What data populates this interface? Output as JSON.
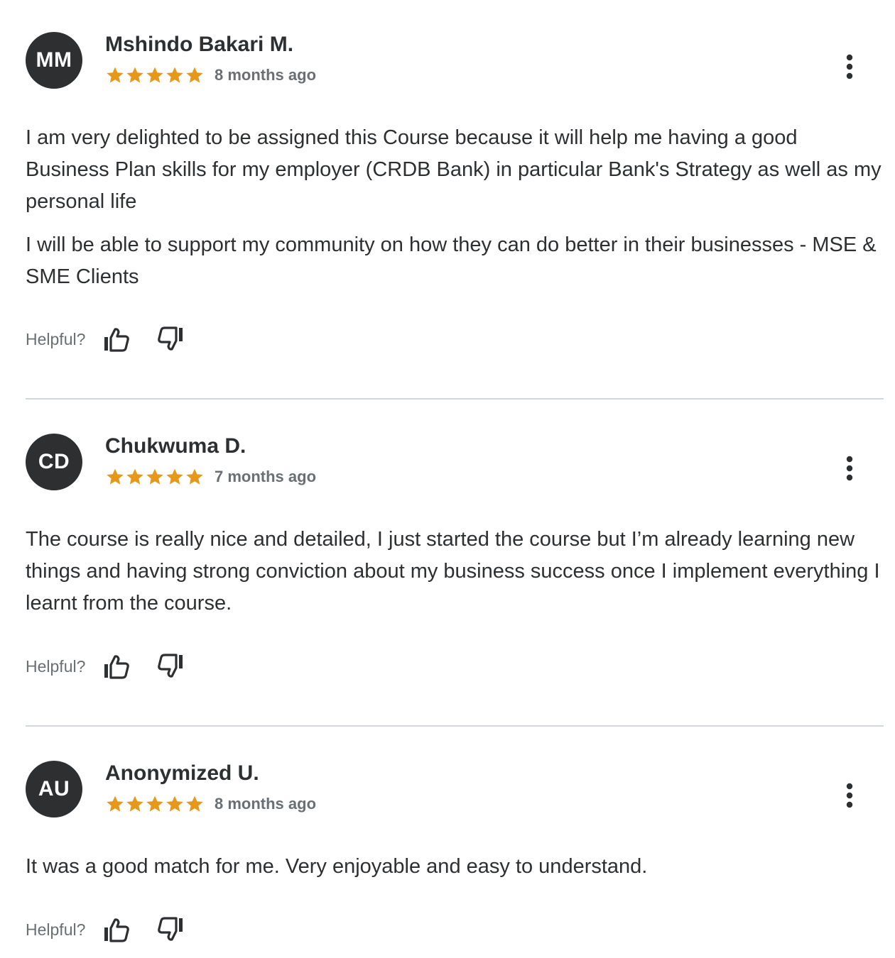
{
  "reviews": [
    {
      "initials": "MM",
      "name": "Mshindo Bakari M.",
      "rating": 5,
      "date": "8 months ago",
      "paragraphs": [
        "I am very delighted to be assigned this Course because it will help me having a good Business Plan skills for my employer (CRDB Bank) in particular Bank's Strategy as well as my personal life",
        "I will be able to support my community on how they can do better in their businesses - MSE & SME Clients"
      ],
      "helpful_label": "Helpful?"
    },
    {
      "initials": "CD",
      "name": "Chukwuma D.",
      "rating": 5,
      "date": "7 months ago",
      "paragraphs": [
        "The course is really nice and detailed, I just started the course but I’m already learning new things and having strong conviction about my business success once I implement everything I learnt from the course."
      ],
      "helpful_label": "Helpful?"
    },
    {
      "initials": "AU",
      "name": "Anonymized U.",
      "rating": 5,
      "date": "8 months ago",
      "paragraphs": [
        "It was a good match for me. Very enjoyable and easy to understand."
      ],
      "helpful_label": "Helpful?"
    }
  ],
  "colors": {
    "avatar_bg": "#2d2f31",
    "star": "#e59819",
    "muted_text": "#6a6f73",
    "divider": "#d1d7dc"
  },
  "icons": {
    "star": "star-icon",
    "menu": "more-vertical-icon",
    "like": "thumbs-up-icon",
    "dislike": "thumbs-down-icon"
  }
}
